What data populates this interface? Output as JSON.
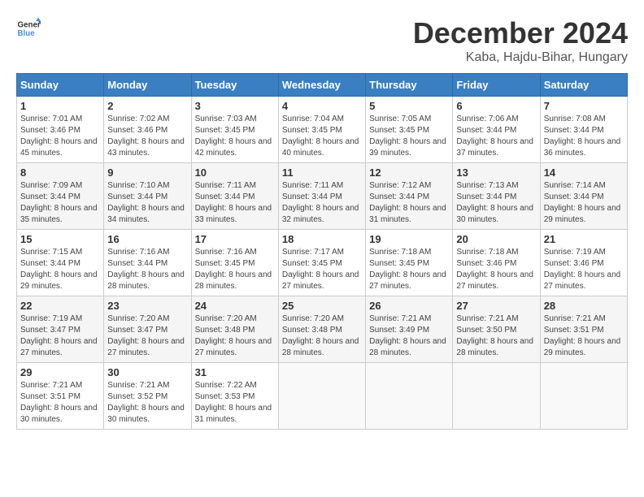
{
  "header": {
    "logo_general": "General",
    "logo_blue": "Blue",
    "month_year": "December 2024",
    "location": "Kaba, Hajdu-Bihar, Hungary"
  },
  "calendar": {
    "days_of_week": [
      "Sunday",
      "Monday",
      "Tuesday",
      "Wednesday",
      "Thursday",
      "Friday",
      "Saturday"
    ],
    "weeks": [
      [
        {
          "day": "1",
          "sunrise": "7:01 AM",
          "sunset": "3:46 PM",
          "daylight": "8 hours and 45 minutes."
        },
        {
          "day": "2",
          "sunrise": "7:02 AM",
          "sunset": "3:46 PM",
          "daylight": "8 hours and 43 minutes."
        },
        {
          "day": "3",
          "sunrise": "7:03 AM",
          "sunset": "3:45 PM",
          "daylight": "8 hours and 42 minutes."
        },
        {
          "day": "4",
          "sunrise": "7:04 AM",
          "sunset": "3:45 PM",
          "daylight": "8 hours and 40 minutes."
        },
        {
          "day": "5",
          "sunrise": "7:05 AM",
          "sunset": "3:45 PM",
          "daylight": "8 hours and 39 minutes."
        },
        {
          "day": "6",
          "sunrise": "7:06 AM",
          "sunset": "3:44 PM",
          "daylight": "8 hours and 37 minutes."
        },
        {
          "day": "7",
          "sunrise": "7:08 AM",
          "sunset": "3:44 PM",
          "daylight": "8 hours and 36 minutes."
        }
      ],
      [
        {
          "day": "8",
          "sunrise": "7:09 AM",
          "sunset": "3:44 PM",
          "daylight": "8 hours and 35 minutes."
        },
        {
          "day": "9",
          "sunrise": "7:10 AM",
          "sunset": "3:44 PM",
          "daylight": "8 hours and 34 minutes."
        },
        {
          "day": "10",
          "sunrise": "7:11 AM",
          "sunset": "3:44 PM",
          "daylight": "8 hours and 33 minutes."
        },
        {
          "day": "11",
          "sunrise": "7:11 AM",
          "sunset": "3:44 PM",
          "daylight": "8 hours and 32 minutes."
        },
        {
          "day": "12",
          "sunrise": "7:12 AM",
          "sunset": "3:44 PM",
          "daylight": "8 hours and 31 minutes."
        },
        {
          "day": "13",
          "sunrise": "7:13 AM",
          "sunset": "3:44 PM",
          "daylight": "8 hours and 30 minutes."
        },
        {
          "day": "14",
          "sunrise": "7:14 AM",
          "sunset": "3:44 PM",
          "daylight": "8 hours and 29 minutes."
        }
      ],
      [
        {
          "day": "15",
          "sunrise": "7:15 AM",
          "sunset": "3:44 PM",
          "daylight": "8 hours and 29 minutes."
        },
        {
          "day": "16",
          "sunrise": "7:16 AM",
          "sunset": "3:44 PM",
          "daylight": "8 hours and 28 minutes."
        },
        {
          "day": "17",
          "sunrise": "7:16 AM",
          "sunset": "3:45 PM",
          "daylight": "8 hours and 28 minutes."
        },
        {
          "day": "18",
          "sunrise": "7:17 AM",
          "sunset": "3:45 PM",
          "daylight": "8 hours and 27 minutes."
        },
        {
          "day": "19",
          "sunrise": "7:18 AM",
          "sunset": "3:45 PM",
          "daylight": "8 hours and 27 minutes."
        },
        {
          "day": "20",
          "sunrise": "7:18 AM",
          "sunset": "3:46 PM",
          "daylight": "8 hours and 27 minutes."
        },
        {
          "day": "21",
          "sunrise": "7:19 AM",
          "sunset": "3:46 PM",
          "daylight": "8 hours and 27 minutes."
        }
      ],
      [
        {
          "day": "22",
          "sunrise": "7:19 AM",
          "sunset": "3:47 PM",
          "daylight": "8 hours and 27 minutes."
        },
        {
          "day": "23",
          "sunrise": "7:20 AM",
          "sunset": "3:47 PM",
          "daylight": "8 hours and 27 minutes."
        },
        {
          "day": "24",
          "sunrise": "7:20 AM",
          "sunset": "3:48 PM",
          "daylight": "8 hours and 27 minutes."
        },
        {
          "day": "25",
          "sunrise": "7:20 AM",
          "sunset": "3:48 PM",
          "daylight": "8 hours and 28 minutes."
        },
        {
          "day": "26",
          "sunrise": "7:21 AM",
          "sunset": "3:49 PM",
          "daylight": "8 hours and 28 minutes."
        },
        {
          "day": "27",
          "sunrise": "7:21 AM",
          "sunset": "3:50 PM",
          "daylight": "8 hours and 28 minutes."
        },
        {
          "day": "28",
          "sunrise": "7:21 AM",
          "sunset": "3:51 PM",
          "daylight": "8 hours and 29 minutes."
        }
      ],
      [
        {
          "day": "29",
          "sunrise": "7:21 AM",
          "sunset": "3:51 PM",
          "daylight": "8 hours and 30 minutes."
        },
        {
          "day": "30",
          "sunrise": "7:21 AM",
          "sunset": "3:52 PM",
          "daylight": "8 hours and 30 minutes."
        },
        {
          "day": "31",
          "sunrise": "7:22 AM",
          "sunset": "3:53 PM",
          "daylight": "8 hours and 31 minutes."
        },
        null,
        null,
        null,
        null
      ]
    ]
  }
}
